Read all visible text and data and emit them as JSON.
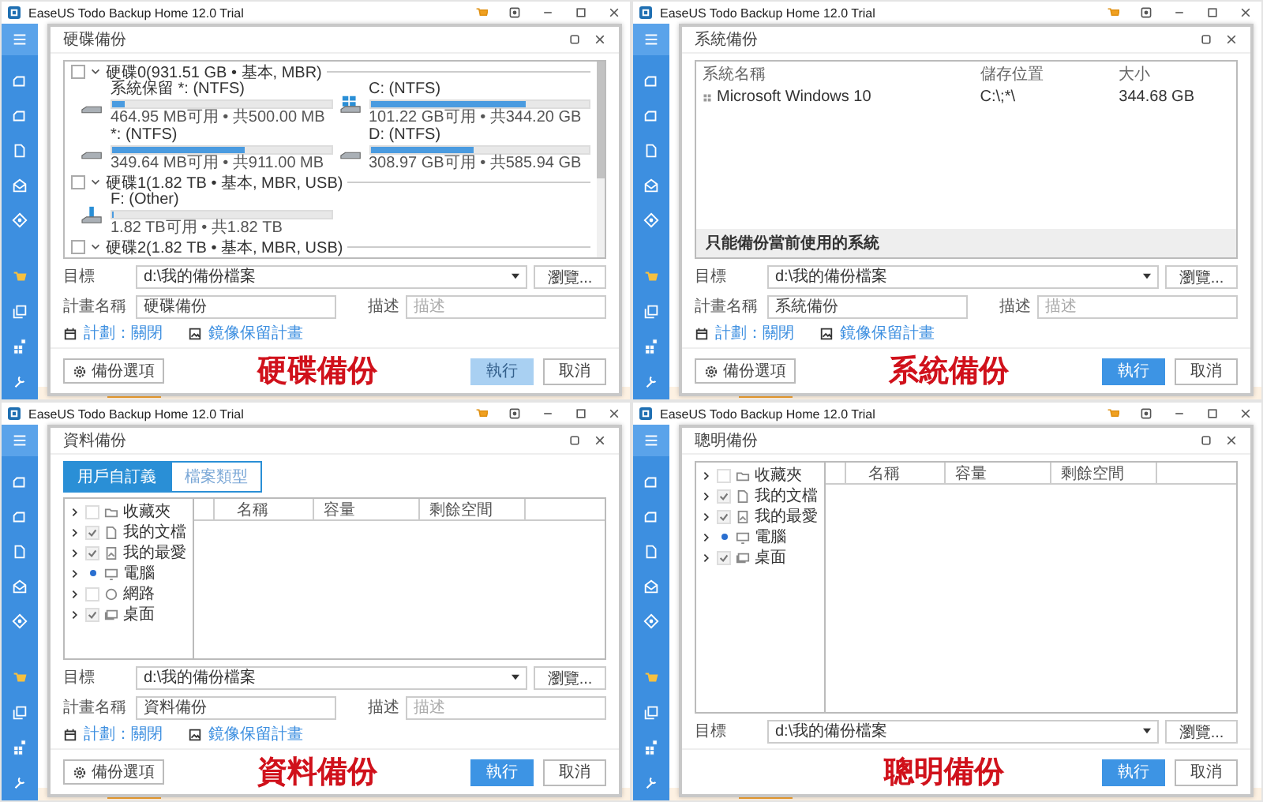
{
  "panels": [
    {
      "kind": "disk",
      "app_title": "EaseUS Todo Backup Home 12.0 Trial",
      "dialog_title": "硬碟備份",
      "disks": [
        {
          "label": "硬碟0(931.51 GB • 基本, MBR)",
          "checked": false,
          "partitions": [
            {
              "kind": "drive",
              "name": "系統保留 *: (NTFS)",
              "level": 0.06,
              "info": "464.95 MB可用 • 共500.00 MB"
            },
            {
              "kind": "windows",
              "name": "C: (NTFS)",
              "level": 0.71,
              "info": "101.22 GB可用 • 共344.20 GB"
            },
            {
              "kind": "drive",
              "name": "*: (NTFS)",
              "level": 0.61,
              "info": "349.64 MB可用 • 共911.00 MB"
            },
            {
              "kind": "drive",
              "name": "D: (NTFS)",
              "level": 0.47,
              "info": "308.97 GB可用 • 共585.94 GB"
            }
          ]
        },
        {
          "label": "硬碟1(1.82 TB • 基本, MBR, USB)",
          "checked": false,
          "partitions": [
            {
              "kind": "usb",
              "name": "F: (Other)",
              "level": 0.01,
              "info": "1.82 TB可用 • 共1.82 TB"
            }
          ]
        },
        {
          "label": "硬碟2(1.82 TB • 基本, MBR, USB)",
          "checked": false
        }
      ],
      "target": {
        "label": "目標",
        "value": "d:\\我的備份檔案",
        "browse": "瀏覽..."
      },
      "plan": {
        "label": "計畫名稱",
        "value": "硬碟備份",
        "desc_label": "描述",
        "desc_placeholder": "描述"
      },
      "links": [
        {
          "kind": "schedule",
          "label": "計劃：關閉"
        },
        {
          "kind": "image",
          "label": "鏡像保留計畫"
        }
      ],
      "options_button": "備份選項",
      "run": {
        "label": "執行",
        "disabled": true
      },
      "cancel": "取消",
      "caption": "硬碟備份"
    },
    {
      "kind": "system",
      "app_title": "EaseUS Todo Backup Home 12.0 Trial",
      "dialog_title": "系統備份",
      "system_table": {
        "columns": [
          "系統名稱",
          "儲存位置",
          "大小"
        ],
        "rows": [
          {
            "cells": [
              "Microsoft Windows 10",
              "C:\\;*\\",
              "344.68 GB"
            ]
          }
        ],
        "note": "只能備份當前使用的系統"
      },
      "target": {
        "label": "目標",
        "value": "d:\\我的備份檔案",
        "browse": "瀏覽..."
      },
      "plan": {
        "label": "計畫名稱",
        "value": "系統備份",
        "desc_label": "描述",
        "desc_placeholder": "描述"
      },
      "links": [
        {
          "kind": "schedule",
          "label": "計劃：關閉"
        },
        {
          "kind": "image",
          "label": "鏡像保留計畫"
        }
      ],
      "options_button": "備份選項",
      "run": {
        "label": "執行",
        "disabled": false
      },
      "cancel": "取消",
      "caption": "系統備份"
    },
    {
      "kind": "file",
      "app_title": "EaseUS Todo Backup Home 12.0 Trial",
      "dialog_title": "資料備份",
      "tabs": [
        {
          "label": "用戶自訂義",
          "selected": true
        },
        {
          "label": "檔案類型",
          "selected": false
        }
      ],
      "tree": [
        {
          "kind": "folder",
          "label": "收藏夾",
          "checked": false
        },
        {
          "kind": "document",
          "label": "我的文檔",
          "checked": true
        },
        {
          "kind": "picture",
          "label": "我的最愛",
          "checked": true
        },
        {
          "kind": "computer",
          "label": "電腦",
          "partial": true
        },
        {
          "kind": "network",
          "label": "網路",
          "checked": false
        },
        {
          "kind": "desktop",
          "label": "桌面",
          "checked": true
        }
      ],
      "columns": [
        "名稱",
        "容量",
        "剩餘空間"
      ],
      "target": {
        "label": "目標",
        "value": "d:\\我的備份檔案",
        "browse": "瀏覽..."
      },
      "plan": {
        "label": "計畫名稱",
        "value": "資料備份",
        "desc_label": "描述",
        "desc_placeholder": "描述"
      },
      "links": [
        {
          "kind": "schedule",
          "label": "計劃：關閉"
        },
        {
          "kind": "image",
          "label": "鏡像保留計畫"
        }
      ],
      "options_button": "備份選項",
      "run": {
        "label": "執行",
        "disabled": false
      },
      "cancel": "取消",
      "caption": "資料備份"
    },
    {
      "kind": "smart",
      "app_title": "EaseUS Todo Backup Home 12.0 Trial",
      "dialog_title": "聰明備份",
      "tree": [
        {
          "kind": "folder",
          "label": "收藏夾",
          "checked": false
        },
        {
          "kind": "document",
          "label": "我的文檔",
          "checked": true
        },
        {
          "kind": "picture",
          "label": "我的最愛",
          "checked": true
        },
        {
          "kind": "computer",
          "label": "電腦",
          "partial": true
        },
        {
          "kind": "desktop",
          "label": "桌面",
          "checked": true
        }
      ],
      "columns": [
        "名稱",
        "容量",
        "剩餘空間"
      ],
      "target": {
        "label": "目標",
        "value": "d:\\我的備份檔案",
        "browse": "瀏覽..."
      },
      "run": {
        "label": "執行",
        "disabled": false
      },
      "cancel": "取消",
      "caption": "聰明備份"
    }
  ]
}
